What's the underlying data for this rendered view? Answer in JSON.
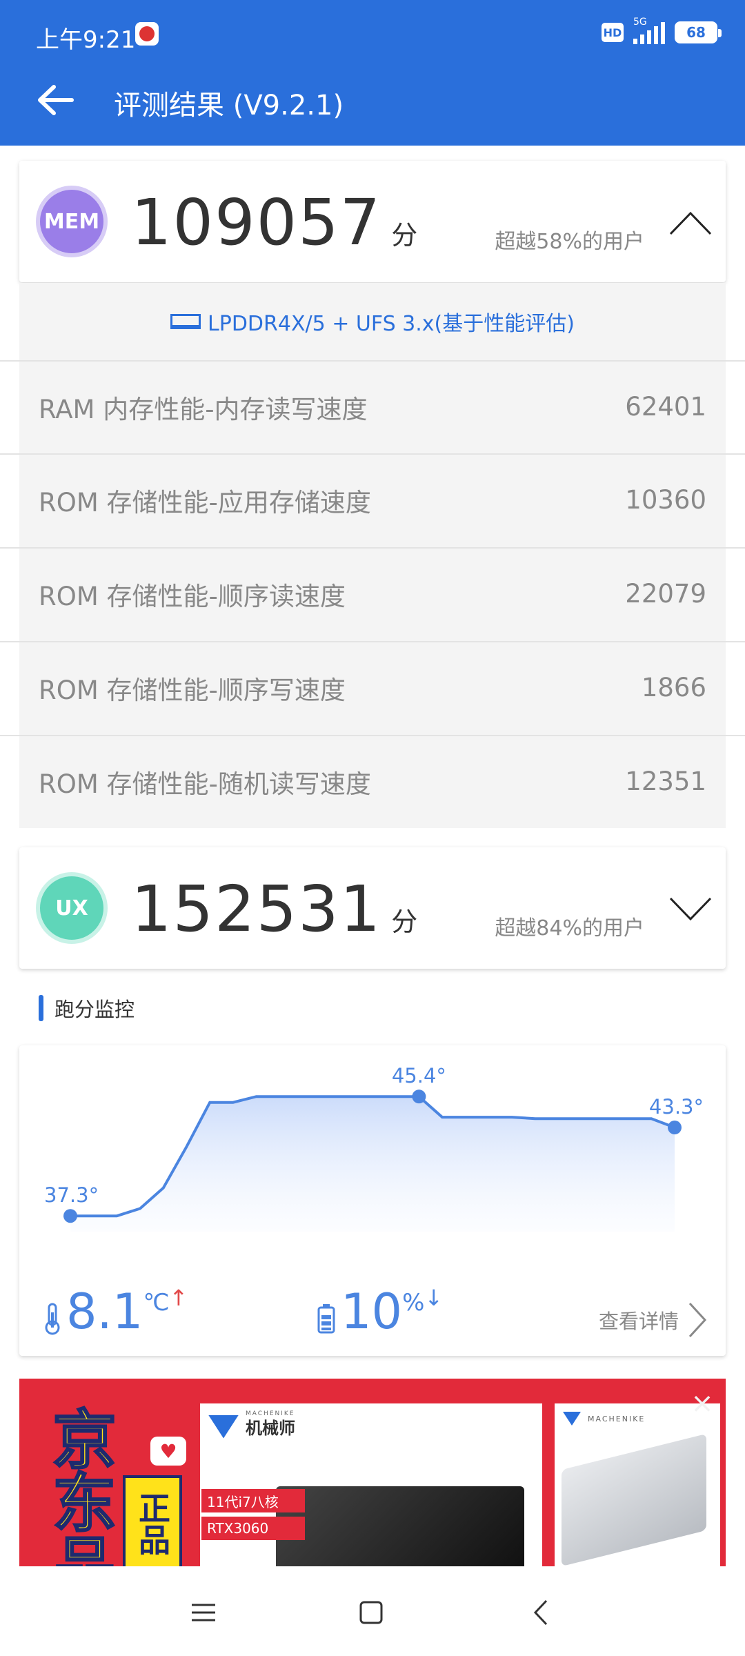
{
  "status_bar": {
    "time": "上午9:21",
    "hd": "HD",
    "network": "5G",
    "battery": "68"
  },
  "header": {
    "title": "评测结果 (V9.2.1)"
  },
  "mem": {
    "badge": "MEM",
    "score": "109057",
    "unit": "分",
    "exceed": "超越58%的用户",
    "spec": "LPDDR4X/5 + UFS 3.x(基于性能评估)",
    "rows": [
      {
        "label": "RAM 内存性能-内存读写速度",
        "value": "62401"
      },
      {
        "label": "ROM 存储性能-应用存储速度",
        "value": "10360"
      },
      {
        "label": "ROM 存储性能-顺序读速度",
        "value": "22079"
      },
      {
        "label": "ROM 存储性能-顺序写速度",
        "value": "1866"
      },
      {
        "label": "ROM 存储性能-随机读写速度",
        "value": "12351"
      }
    ]
  },
  "ux": {
    "badge": "UX",
    "score": "152531",
    "unit": "分",
    "exceed": "超越84%的用户"
  },
  "monitor": {
    "title": "跑分监控",
    "temp_delta": "8.1",
    "temp_unit": "℃",
    "battery_delta": "10",
    "battery_unit": "%",
    "detail": "查看详情"
  },
  "chart_data": {
    "type": "area",
    "x": [
      0,
      1,
      2,
      3,
      4,
      5,
      6,
      7,
      8,
      9,
      10,
      11,
      12,
      13,
      14,
      15,
      16,
      17,
      18,
      19,
      20,
      21,
      22,
      23,
      24,
      25,
      26
    ],
    "values": [
      37.3,
      37.3,
      37.3,
      37.8,
      39.2,
      42.0,
      45.0,
      45.0,
      45.4,
      45.4,
      45.4,
      45.4,
      45.4,
      45.4,
      45.4,
      45.4,
      44.0,
      44.0,
      44.0,
      44.0,
      43.9,
      43.9,
      43.9,
      43.9,
      43.9,
      43.9,
      43.3
    ],
    "labels": [
      {
        "index": 0,
        "text": "37.3°"
      },
      {
        "index": 15,
        "text": "45.4°"
      },
      {
        "index": 26,
        "text": "43.3°"
      }
    ],
    "ylim": [
      36,
      47
    ],
    "grid": false,
    "color": "#4b85e0"
  },
  "ad": {
    "store": "京东品",
    "genuine": "正品",
    "brand_cn": "机械师",
    "brand_en": "MACHENIKE",
    "tags": [
      "11代i7八核",
      "RTX3060"
    ],
    "close": "×"
  },
  "colors": {
    "primary": "#2a6fdb",
    "accent": "#4b85e0",
    "mem_badge": "#9a7ee8",
    "ux_badge": "#5fd6b9",
    "ad_red": "#e22a3a"
  }
}
